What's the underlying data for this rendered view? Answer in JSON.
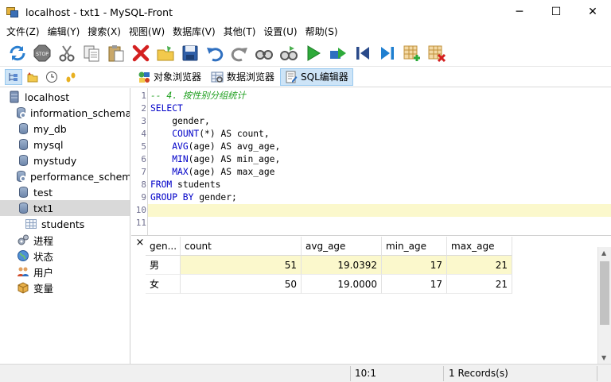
{
  "window": {
    "title": "localhost - txt1 - MySQL-Front",
    "minimize": "─",
    "maximize": "☐",
    "close": "✕"
  },
  "menu": [
    "文件(Z)",
    "编辑(Y)",
    "搜索(X)",
    "视图(W)",
    "数据库(V)",
    "其他(T)",
    "设置(U)",
    "帮助(S)"
  ],
  "toolbar": {
    "icons": [
      "refresh-icon",
      "stop-icon",
      "cut-icon",
      "copy-icon",
      "paste-icon",
      "delete-icon",
      "open-icon",
      "save-icon",
      "undo-icon",
      "redo-icon",
      "search-icon",
      "replace-icon",
      "run-icon",
      "run-line-icon",
      "first-icon",
      "last-icon",
      "insert-row-icon",
      "delete-row-icon"
    ]
  },
  "tabs": [
    {
      "label": "对象浏览器",
      "icon": "object-browser-icon",
      "active": false
    },
    {
      "label": "数据浏览器",
      "icon": "data-browser-icon",
      "active": false
    },
    {
      "label": "SQL编辑器",
      "icon": "sql-editor-icon",
      "active": true
    }
  ],
  "tree": {
    "root": "localhost",
    "databases": [
      "information_schema",
      "my_db",
      "mysql",
      "mystudy",
      "performance_schema",
      "test",
      "txt1"
    ],
    "selected": "txt1",
    "tables": [
      "students"
    ],
    "extras": [
      "进程",
      "状态",
      "用户",
      "变量"
    ]
  },
  "editor": {
    "line_numbers": [
      "1",
      "2",
      "3",
      "4",
      "5",
      "6",
      "7",
      "8",
      "9",
      "10",
      "11"
    ],
    "current_line": "10",
    "comment": "-- 4. 按性别分组统计",
    "select_kw": "SELECT",
    "col_gender": "    gender,",
    "count_fn": "COUNT",
    "count_rest": "(*) AS count,",
    "avg_fn": "AVG",
    "avg_rest": "(age) AS avg_age,",
    "min_fn": "MIN",
    "min_rest": "(age) AS min_age,",
    "max_fn": "MAX",
    "max_rest": "(age) AS max_age",
    "from_kw": "FROM",
    "from_rest": " students",
    "group_kw": "GROUP BY",
    "group_rest": " gender;"
  },
  "results": {
    "close": "×",
    "columns": [
      "gen...",
      "count",
      "avg_age",
      "min_age",
      "max_age"
    ],
    "rows": [
      [
        "男",
        "51",
        "19.0392",
        "17",
        "21"
      ],
      [
        "女",
        "50",
        "19.0000",
        "17",
        "21"
      ]
    ]
  },
  "status": {
    "position": "10:1",
    "records": "1 Records(s)"
  }
}
